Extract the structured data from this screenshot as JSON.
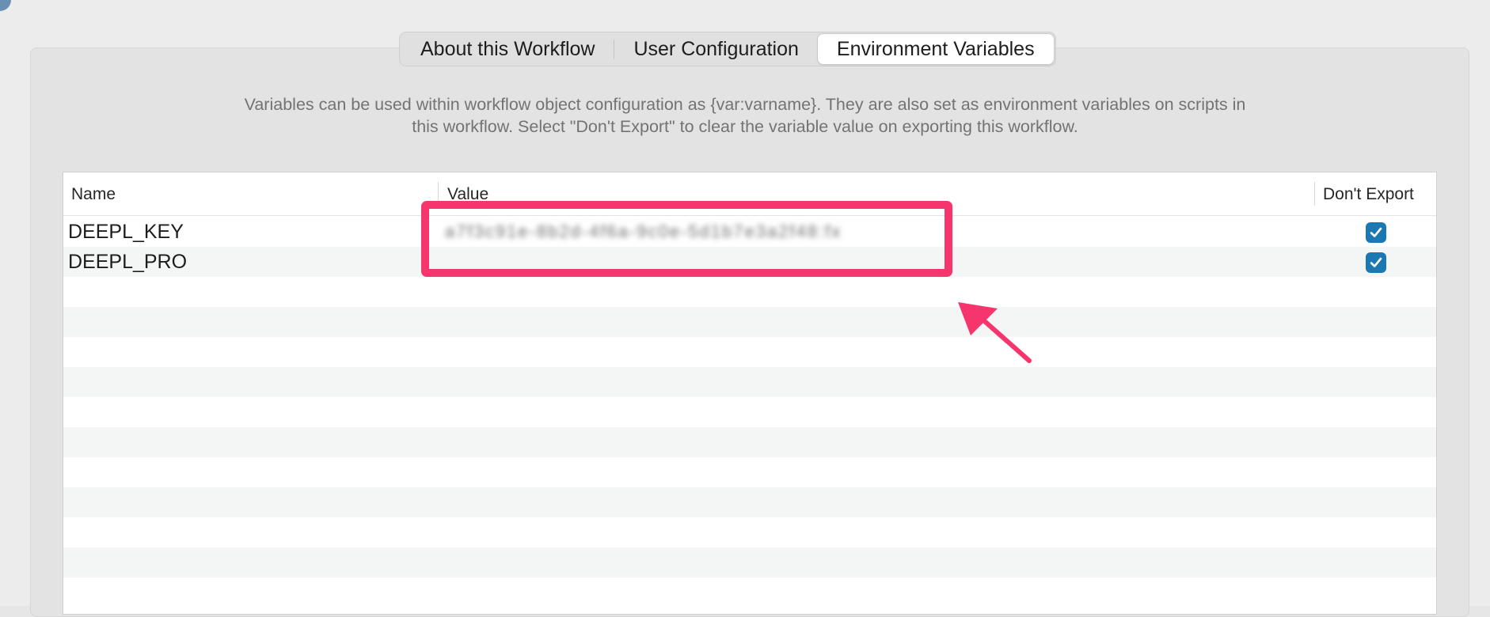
{
  "tabs": [
    {
      "label": "About this Workflow",
      "selected": false
    },
    {
      "label": "User Configuration",
      "selected": false
    },
    {
      "label": "Environment Variables",
      "selected": true
    }
  ],
  "description": "Variables can be used within workflow object configuration as {var:varname}. They are also set as environment variables on scripts in this workflow. Select \"Don't Export\" to clear the variable value on exporting this workflow.",
  "table": {
    "columns": {
      "name": "Name",
      "value": "Value",
      "dont_export": "Don't Export"
    },
    "rows": [
      {
        "name": "DEEPL_KEY",
        "value": "a7f3c91e-8b2d-4f6a-9c0e-5d1b7e3a2f48:fx",
        "dont_export": true
      },
      {
        "name": "DEEPL_PRO",
        "value": "",
        "dont_export": true
      }
    ]
  },
  "colors": {
    "highlight": "#f6356d",
    "checkbox": "#1b78b3",
    "selected_tab": "#ffffff"
  },
  "icons": {
    "checkbox_checked": "checkmark-icon",
    "annotation_arrow": "arrow-icon"
  }
}
